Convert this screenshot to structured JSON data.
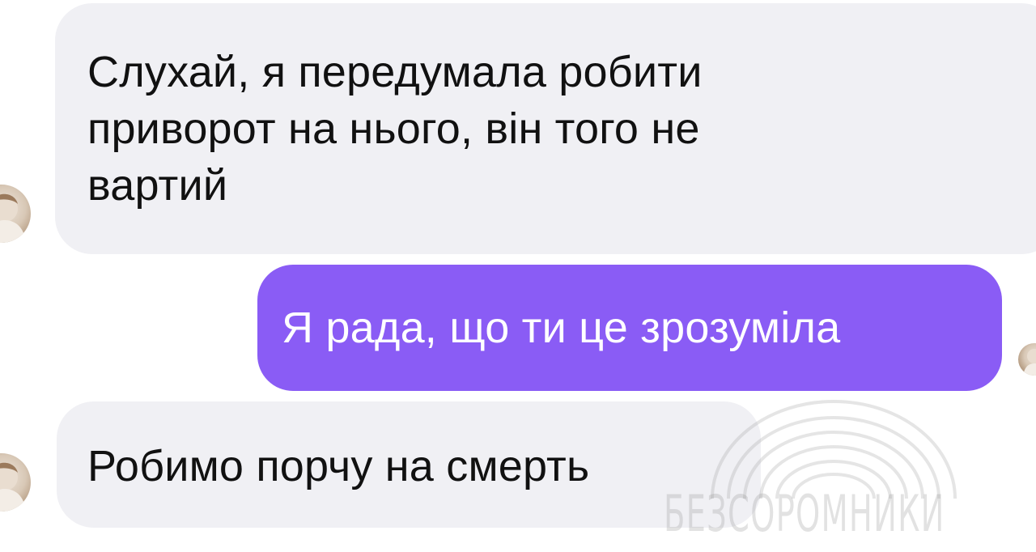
{
  "messages": [
    {
      "direction": "incoming",
      "text": "Слухай, я передумала робити\nприворот на нього, він того не\nвартий"
    },
    {
      "direction": "outgoing",
      "text": "Я рада, що ти це зрозуміла"
    },
    {
      "direction": "incoming",
      "text": "Робимо порчу на смерть"
    }
  ],
  "watermark": {
    "text": "БЕЗСОРОМНИКИ",
    "icon": "rainbow-arc-logo"
  },
  "colors": {
    "incoming_bubble": "#f0f0f4",
    "outgoing_bubble": "#8a5cf5",
    "incoming_text": "#111111",
    "outgoing_text": "#ffffff"
  }
}
